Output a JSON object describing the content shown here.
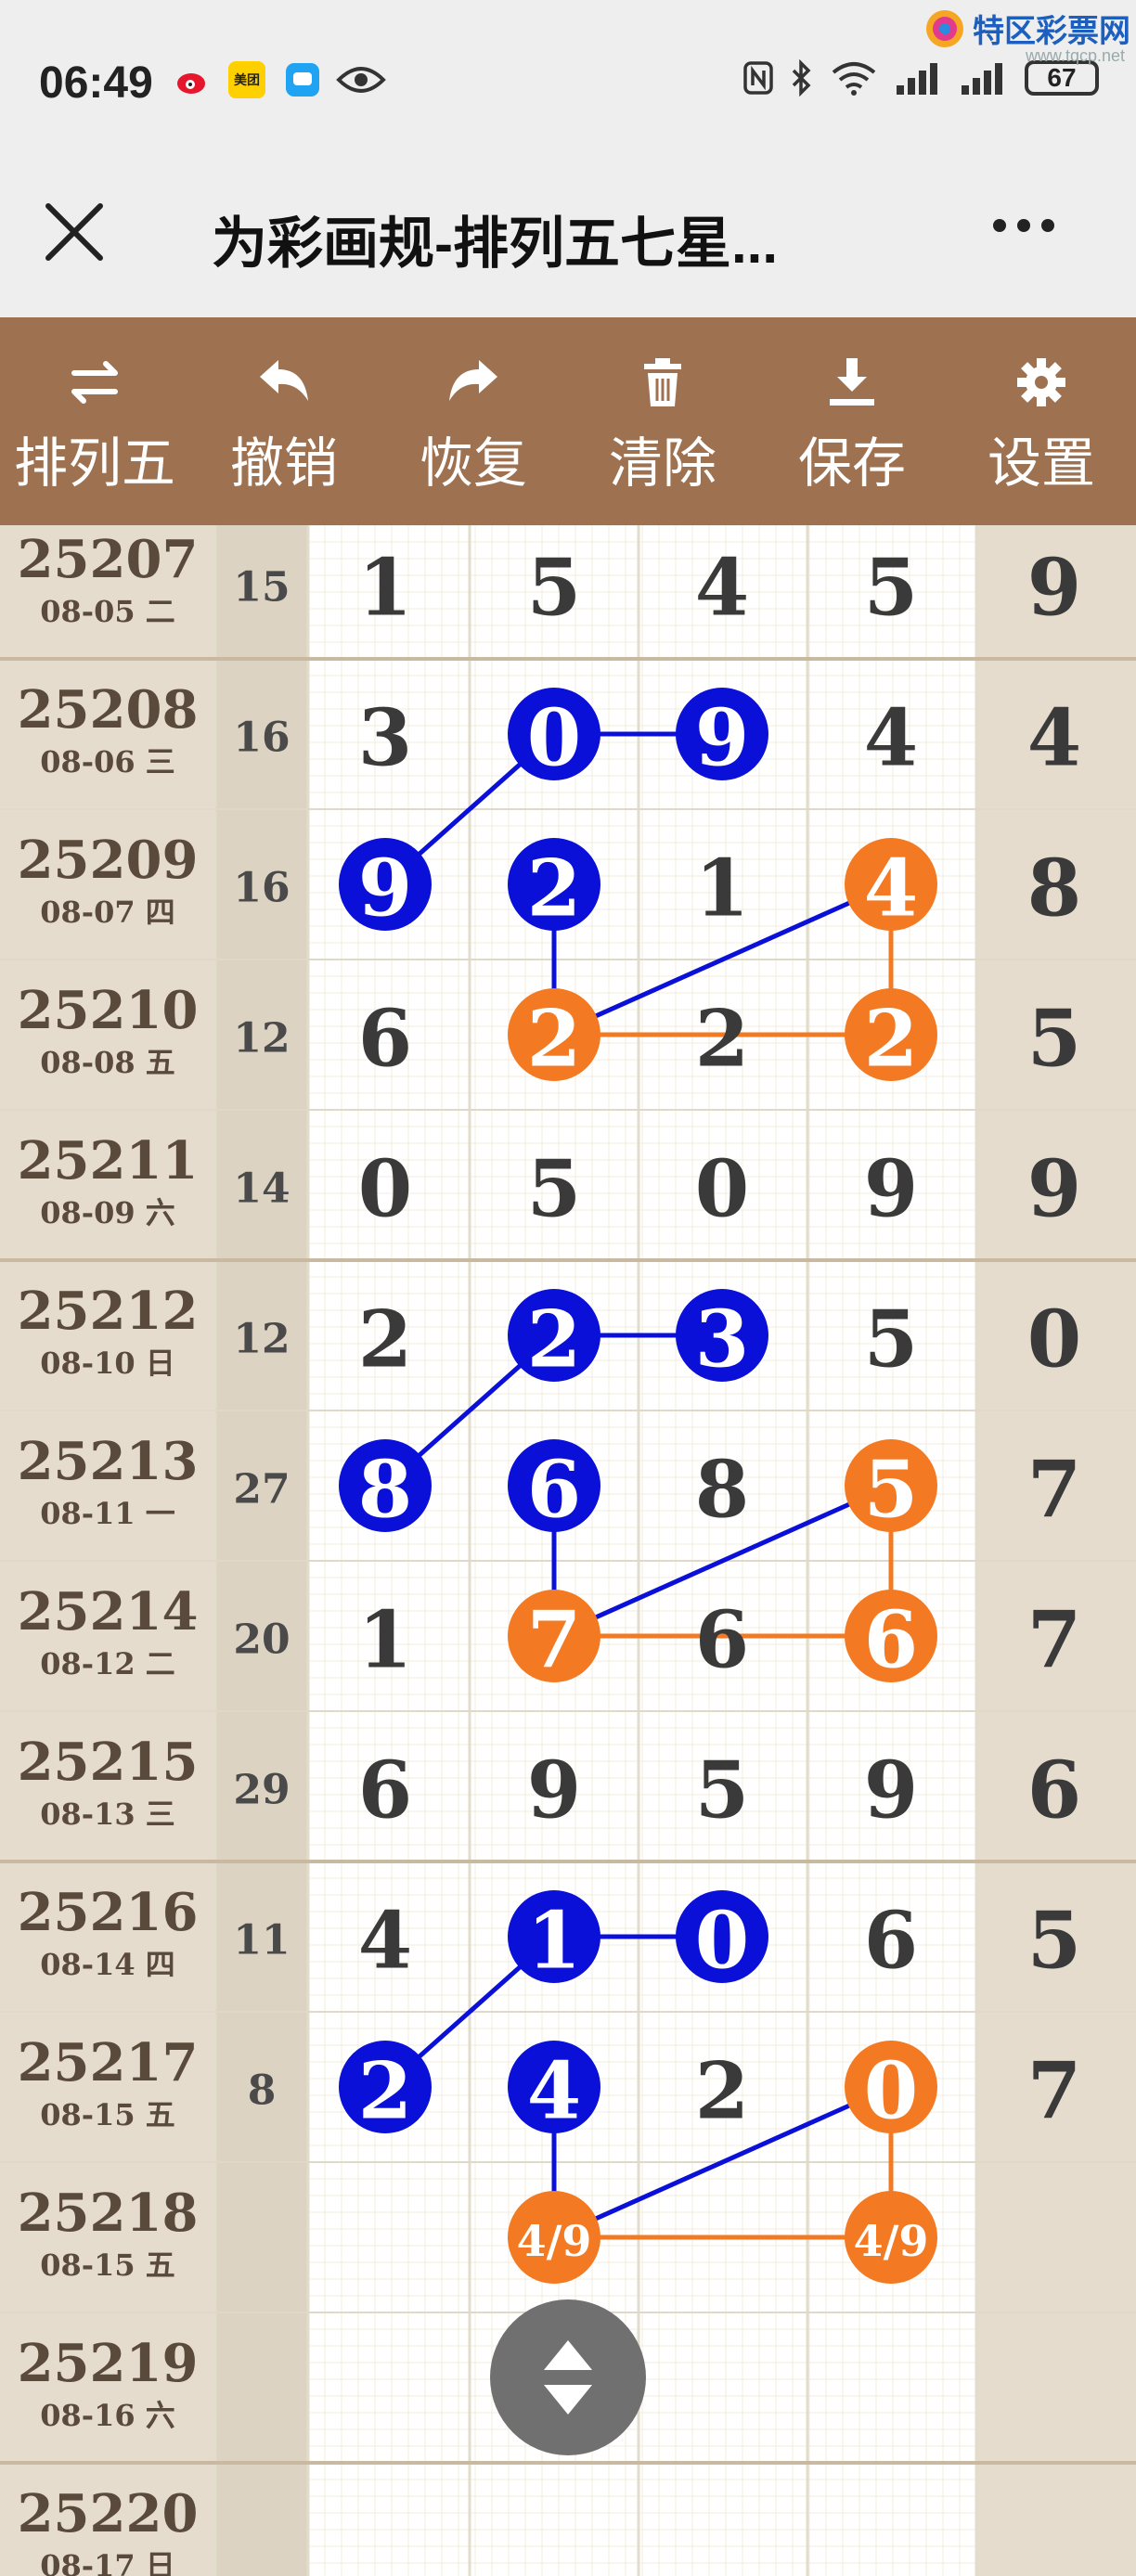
{
  "status_bar": {
    "time": "06:49",
    "battery": "67",
    "icons": [
      "weibo-icon",
      "meituan-icon",
      "chat-icon",
      "eye-icon",
      "nfc-icon",
      "bluetooth-icon",
      "wifi-icon",
      "signal-icon",
      "signal-icon",
      "battery-icon"
    ],
    "meituan_label": "美团"
  },
  "watermark": {
    "name": "特区彩票网",
    "url": "www.tqcp.net"
  },
  "title_bar": {
    "title": "为彩画规-排列五七星..."
  },
  "toolbar": {
    "items": [
      {
        "label": "排列五",
        "icon": "swap-icon"
      },
      {
        "label": "撤销",
        "icon": "undo-icon"
      },
      {
        "label": "恢复",
        "icon": "redo-icon"
      },
      {
        "label": "清除",
        "icon": "trash-icon"
      },
      {
        "label": "保存",
        "icon": "download-icon"
      },
      {
        "label": "设置",
        "icon": "gear-icon"
      }
    ]
  },
  "colors": {
    "toolbar": "#9e7150",
    "side_bg": "#e6dccd",
    "blue": "#0a10d8",
    "orange": "#f37a22",
    "digit": "#3a3a3a"
  },
  "rows": [
    {
      "issue": "25207",
      "date": "08-05 二",
      "sum": "15",
      "digits": [
        "1",
        "5",
        "4",
        "5",
        "9"
      ]
    },
    {
      "issue": "25208",
      "date": "08-06 三",
      "sum": "16",
      "digits": [
        "3",
        "0",
        "9",
        "4",
        "4"
      ]
    },
    {
      "issue": "25209",
      "date": "08-07 四",
      "sum": "16",
      "digits": [
        "9",
        "2",
        "1",
        "4",
        "8"
      ]
    },
    {
      "issue": "25210",
      "date": "08-08 五",
      "sum": "12",
      "digits": [
        "6",
        "2",
        "2",
        "2",
        "5"
      ]
    },
    {
      "issue": "25211",
      "date": "08-09 六",
      "sum": "14",
      "digits": [
        "0",
        "5",
        "0",
        "9",
        "9"
      ]
    },
    {
      "issue": "25212",
      "date": "08-10 日",
      "sum": "12",
      "digits": [
        "2",
        "2",
        "3",
        "5",
        "0"
      ]
    },
    {
      "issue": "25213",
      "date": "08-11 一",
      "sum": "27",
      "digits": [
        "8",
        "6",
        "8",
        "5",
        "7"
      ]
    },
    {
      "issue": "25214",
      "date": "08-12 二",
      "sum": "20",
      "digits": [
        "1",
        "7",
        "6",
        "6",
        "7"
      ]
    },
    {
      "issue": "25215",
      "date": "08-13 三",
      "sum": "29",
      "digits": [
        "6",
        "9",
        "5",
        "9",
        "6"
      ]
    },
    {
      "issue": "25216",
      "date": "08-14 四",
      "sum": "11",
      "digits": [
        "4",
        "1",
        "0",
        "6",
        "5"
      ]
    },
    {
      "issue": "25217",
      "date": "08-15 五",
      "sum": "8",
      "digits": [
        "2",
        "4",
        "2",
        "0",
        "7"
      ]
    },
    {
      "issue": "25218",
      "date": "08-15 五",
      "sum": "",
      "digits": [
        "",
        "4/9",
        "",
        "4/9",
        ""
      ]
    },
    {
      "issue": "25219",
      "date": "08-16 六",
      "sum": "",
      "digits": [
        "",
        "",
        "",
        "",
        ""
      ]
    },
    {
      "issue": "25220",
      "date": "08-17 日",
      "sum": "",
      "digits": [
        "",
        "",
        "",
        "",
        ""
      ]
    }
  ],
  "marks": [
    {
      "row": 1,
      "col": 1,
      "color": "blue"
    },
    {
      "row": 1,
      "col": 2,
      "color": "blue"
    },
    {
      "row": 2,
      "col": 0,
      "color": "blue"
    },
    {
      "row": 2,
      "col": 1,
      "color": "blue"
    },
    {
      "row": 2,
      "col": 3,
      "color": "orange"
    },
    {
      "row": 3,
      "col": 1,
      "color": "orange"
    },
    {
      "row": 3,
      "col": 3,
      "color": "orange"
    },
    {
      "row": 5,
      "col": 1,
      "color": "blue"
    },
    {
      "row": 5,
      "col": 2,
      "color": "blue"
    },
    {
      "row": 6,
      "col": 0,
      "color": "blue"
    },
    {
      "row": 6,
      "col": 1,
      "color": "blue"
    },
    {
      "row": 6,
      "col": 3,
      "color": "orange"
    },
    {
      "row": 7,
      "col": 1,
      "color": "orange"
    },
    {
      "row": 7,
      "col": 3,
      "color": "orange"
    },
    {
      "row": 9,
      "col": 1,
      "color": "blue"
    },
    {
      "row": 9,
      "col": 2,
      "color": "blue"
    },
    {
      "row": 10,
      "col": 0,
      "color": "blue"
    },
    {
      "row": 10,
      "col": 1,
      "color": "blue"
    },
    {
      "row": 10,
      "col": 3,
      "color": "orange"
    },
    {
      "row": 11,
      "col": 1,
      "color": "orange"
    },
    {
      "row": 11,
      "col": 3,
      "color": "orange"
    }
  ],
  "lines": [
    {
      "from": [
        1,
        1
      ],
      "to": [
        1,
        2
      ],
      "color": "blue"
    },
    {
      "from": [
        1,
        1
      ],
      "to": [
        2,
        0
      ],
      "color": "blue"
    },
    {
      "from": [
        2,
        1
      ],
      "to": [
        3,
        1
      ],
      "color": "blue"
    },
    {
      "from": [
        2,
        3
      ],
      "to": [
        3,
        1
      ],
      "color": "blue"
    },
    {
      "from": [
        2,
        3
      ],
      "to": [
        3,
        3
      ],
      "color": "orange"
    },
    {
      "from": [
        3,
        1
      ],
      "to": [
        3,
        3
      ],
      "color": "orange"
    },
    {
      "from": [
        5,
        1
      ],
      "to": [
        5,
        2
      ],
      "color": "blue"
    },
    {
      "from": [
        5,
        1
      ],
      "to": [
        6,
        0
      ],
      "color": "blue"
    },
    {
      "from": [
        6,
        1
      ],
      "to": [
        7,
        1
      ],
      "color": "blue"
    },
    {
      "from": [
        6,
        3
      ],
      "to": [
        7,
        1
      ],
      "color": "blue"
    },
    {
      "from": [
        6,
        3
      ],
      "to": [
        7,
        3
      ],
      "color": "orange"
    },
    {
      "from": [
        7,
        1
      ],
      "to": [
        7,
        3
      ],
      "color": "orange"
    },
    {
      "from": [
        9,
        1
      ],
      "to": [
        9,
        2
      ],
      "color": "blue"
    },
    {
      "from": [
        9,
        1
      ],
      "to": [
        10,
        0
      ],
      "color": "blue"
    },
    {
      "from": [
        10,
        1
      ],
      "to": [
        11,
        1
      ],
      "color": "blue"
    },
    {
      "from": [
        10,
        3
      ],
      "to": [
        11,
        1
      ],
      "color": "blue"
    },
    {
      "from": [
        10,
        3
      ],
      "to": [
        11,
        3
      ],
      "color": "orange"
    },
    {
      "from": [
        11,
        1
      ],
      "to": [
        11,
        3
      ],
      "color": "orange"
    }
  ],
  "fab": {
    "icon": "scroll-updown-icon"
  }
}
